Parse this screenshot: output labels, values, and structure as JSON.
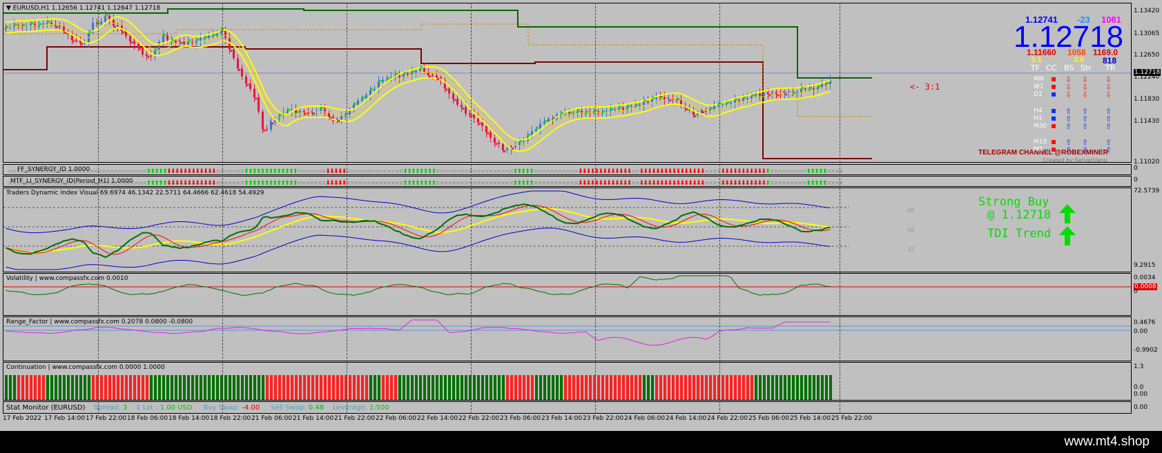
{
  "symbol_header": "▼ EURUSD,H1  1.12656 1.12741 1.12647 1.12718",
  "main_axis": [
    "1.13420",
    "1.13065",
    "1.12650",
    "1.12240",
    "1.11830",
    "1.11430",
    "1.11020"
  ],
  "current_price_label": "1.12718",
  "ratio_label": "<- 3:1",
  "info_panel": {
    "high": "1.12741",
    "change": "-23",
    "pips": "1081",
    "big_price": "1.12718",
    "low": "1.11660",
    "v1": "1058",
    "v2": "1169.0",
    "ratio": "3:1",
    "ratio_val": "3.0",
    "count": "818",
    "col_headers": [
      "TF",
      "CC",
      "BS",
      "Str",
      "TR"
    ],
    "timeframes": [
      "MN",
      "W1",
      "D1",
      "H4",
      "H1",
      "M30",
      "M15",
      "M5"
    ],
    "telegram": "TELEGRAM CHANNEL   @ROBEXMINER",
    "credit": "Created by ServerUang"
  },
  "synergy1_label": "FF_SYNERGY_ID 1.0000",
  "synergy2_label": "MTF_LI_SYNERGY_ID(Period_H1) 1.0000",
  "synergy_axis": [
    "0",
    "0"
  ],
  "tdi_label": "Traders Dynamic Index Visual 69.6974 46.1342 22.5711 64.4666 62.4618 54.4929",
  "tdi_axis": [
    "72.5739",
    "9.2915"
  ],
  "tdi_levels": [
    "68",
    "50",
    "32"
  ],
  "tdi_signal": {
    "line1": "Strong Buy",
    "line2": "@ 1.12718",
    "line3": "TDI Trend"
  },
  "volatility_label": "Volatility | www.compassfx.com  0.0010",
  "volatility_axis": [
    "0.0034",
    "0.0008",
    "0"
  ],
  "range_label": "Range_Factor | www.compassfx.com   0.2078 0.0800 -0.0800",
  "range_axis": [
    "0.4676",
    "0.00",
    "-0.9902"
  ],
  "continuation_label": "Continuation | www.compassfx.com   0.0000 1.0000",
  "continuation_axis": [
    "1.3",
    "0.0",
    "0.00"
  ],
  "stat_monitor": {
    "name": "Stat Monitor (EURUSD)",
    "spread_label": "Spread:",
    "spread": "3",
    "lot_label": "1 Lot :",
    "lot": "1.00 USD",
    "buy_label": "Buy Swap:",
    "buy": "-4.00",
    "sell_label": "Sell Swap:",
    "sell": "0.48",
    "lev_label": "Leverage:",
    "lev": "1:500"
  },
  "stat_axis": [
    "0.00"
  ],
  "time_axis": [
    "17 Feb 2022",
    "17 Feb 14:00",
    "17 Feb 22:00",
    "18 Feb 06:00",
    "18 Feb 14:00",
    "18 Feb 22:00",
    "21 Feb 06:00",
    "21 Feb 14:00",
    "21 Feb 22:00",
    "22 Feb 06:00",
    "22 Feb 14:00",
    "22 Feb 22:00",
    "23 Feb 06:00",
    "23 Feb 14:00",
    "23 Feb 22:00",
    "24 Feb 06:00",
    "24 Feb 14:00",
    "24 Feb 22:00",
    "25 Feb 06:00",
    "25 Feb 14:00",
    "25 Feb 22:00"
  ],
  "watermark": "www.mt4.shop",
  "colors": {
    "bull": "#3f6fe0",
    "bear": "#e8163c",
    "green": "#00dd00",
    "yellow": "#ffff00",
    "darkgreen": "#006400",
    "darkred": "#7a0000",
    "tdi_green": "#007000",
    "tdi_red": "#ff0000",
    "blue": "#0000cc"
  }
}
